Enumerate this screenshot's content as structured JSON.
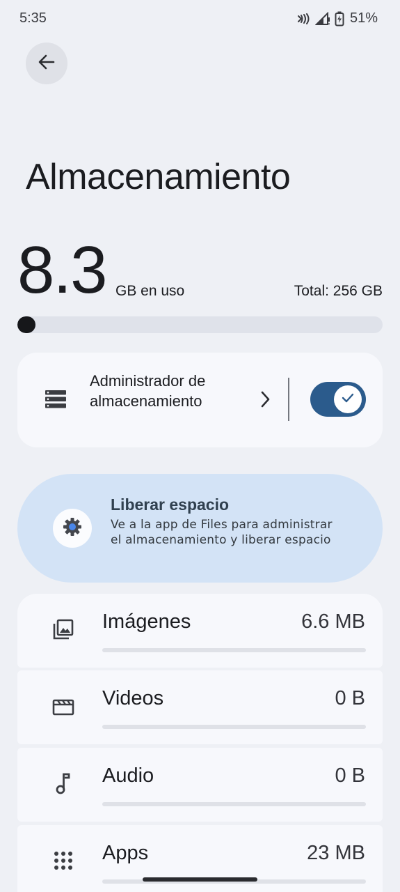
{
  "status_bar": {
    "time": "5:35",
    "battery": "51%",
    "icons": [
      "nfc-icon",
      "signal-icon",
      "battery-charging-icon"
    ]
  },
  "header": {
    "back_icon": "arrow-back-icon",
    "title": "Almacenamiento"
  },
  "usage": {
    "used_value": "8.3",
    "used_unit": "GB en uso",
    "total": "Total: 256 GB",
    "fill_fraction": 0.032
  },
  "storage_manager": {
    "label": "Administrador de almacenamiento",
    "icon": "storage-list-icon",
    "chevron_icon": "chevron-right-icon",
    "toggle_on": true,
    "toggle_color": "#2b5b8c"
  },
  "free_space": {
    "title": "Liberar espacio",
    "description": "Ve a la app de Files para administrar el almacenamiento y liberar espacio",
    "icon": "gear-icon",
    "background": "#d3e3f6"
  },
  "categories": [
    {
      "name": "Imágenes",
      "size": "6.6 MB",
      "icon": "image-icon",
      "fill_fraction": 0
    },
    {
      "name": "Videos",
      "size": "0 B",
      "icon": "video-icon",
      "fill_fraction": 0
    },
    {
      "name": "Audio",
      "size": "0 B",
      "icon": "music-note-icon",
      "fill_fraction": 0
    },
    {
      "name": "Apps",
      "size": "23 MB",
      "icon": "apps-grid-icon",
      "fill_fraction": 0
    }
  ]
}
